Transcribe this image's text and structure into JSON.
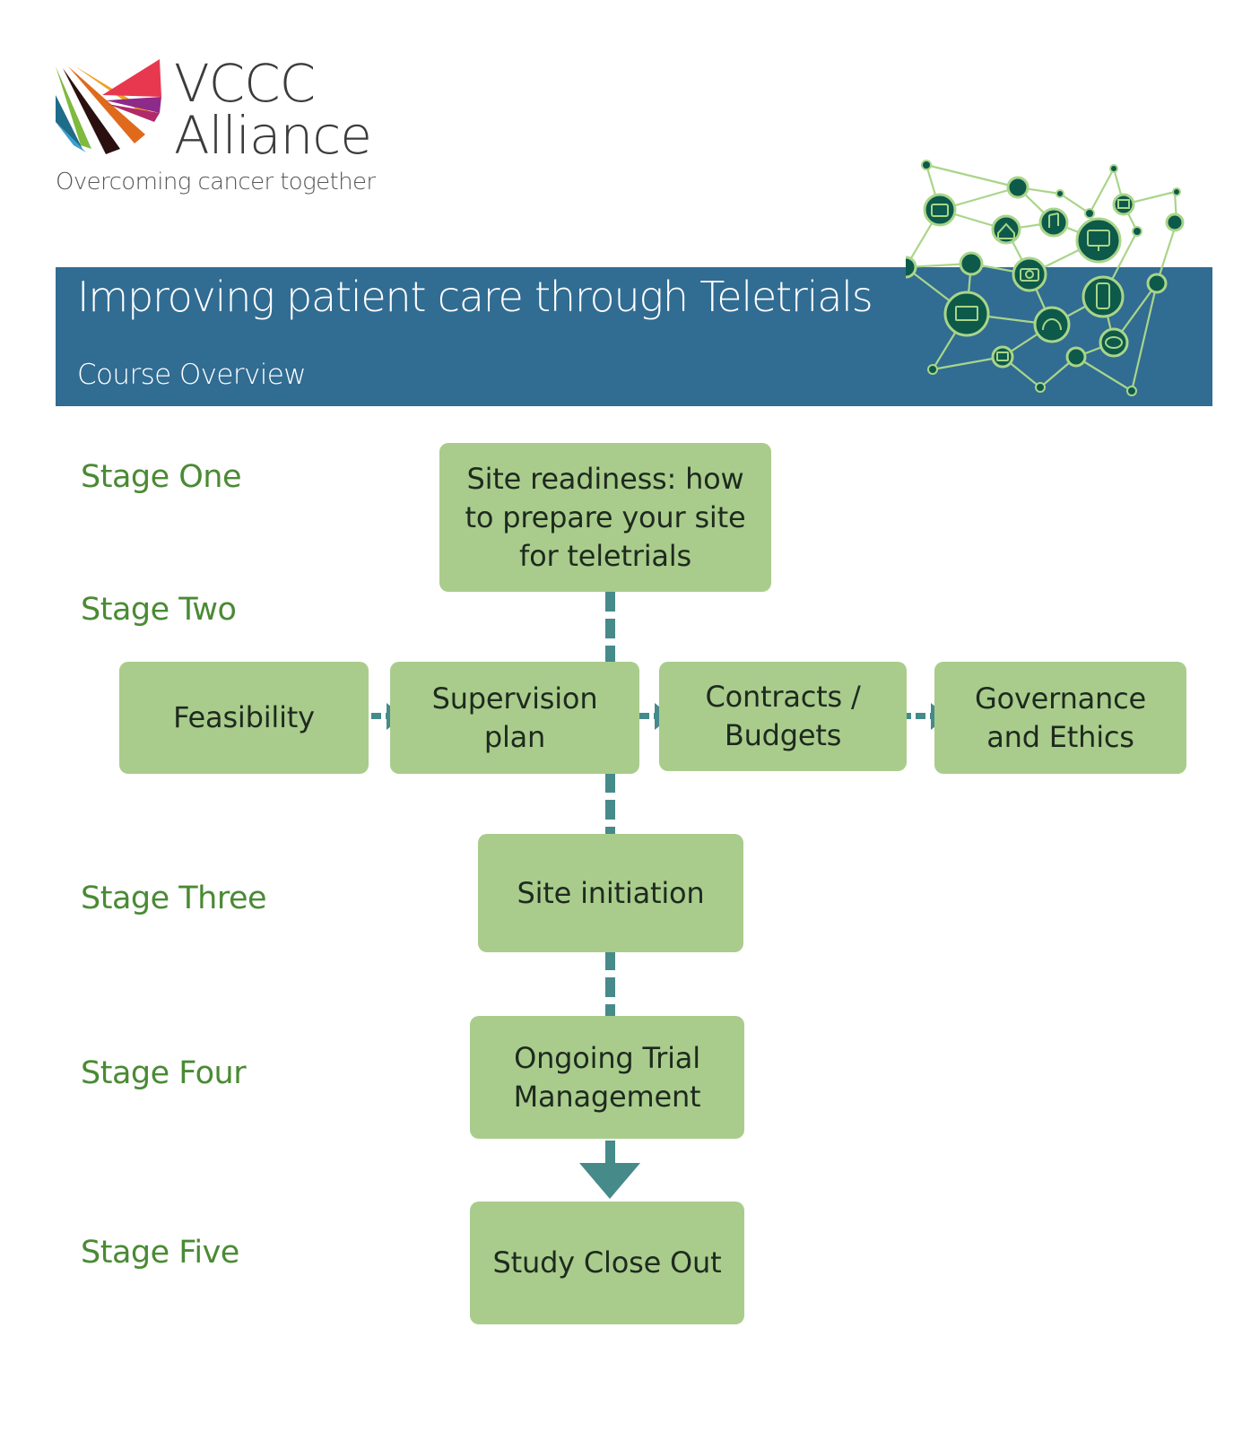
{
  "logo": {
    "line1": "VCCC",
    "line2": "Alliance",
    "tagline": "Overcoming cancer together",
    "colors": [
      "#7dba3e",
      "#f0a020",
      "#e06a1c",
      "#2b1010",
      "#2a7fb0",
      "#c4246b",
      "#8e2a8a",
      "#e8384f"
    ]
  },
  "banner": {
    "title": "Improving patient care through Teletrials",
    "subtitle": "Course Overview",
    "background": "#316c92",
    "network_icons": [
      "briefcase-icon",
      "thumbs-up-icon",
      "home-icon",
      "music-icon",
      "email-icon",
      "monitor-icon",
      "gear-icon",
      "star-icon",
      "download-icon",
      "camera-icon",
      "smartphone-icon",
      "photo-icon",
      "laptop-settings-icon",
      "headphones-icon",
      "chat-icon",
      "video-play-icon",
      "settings-icon"
    ]
  },
  "stages": [
    {
      "label": "Stage One"
    },
    {
      "label": "Stage Two"
    },
    {
      "label": "Stage Three"
    },
    {
      "label": "Stage Four"
    },
    {
      "label": "Stage Five"
    }
  ],
  "nodes": {
    "site_readiness": {
      "lines": [
        "Site readiness:  how",
        "to prepare your site",
        "for teletrials"
      ]
    },
    "feasibility": {
      "lines": [
        "Feasibility"
      ]
    },
    "supervision": {
      "lines": [
        "Supervision",
        "plan"
      ]
    },
    "contracts": {
      "lines": [
        "Contracts /",
        "Budgets"
      ]
    },
    "governance": {
      "lines": [
        "Governance",
        "and Ethics"
      ]
    },
    "site_initiation": {
      "lines": [
        "Site initiation"
      ]
    },
    "ongoing": {
      "lines": [
        "Ongoing Trial",
        "Management"
      ]
    },
    "close_out": {
      "lines": [
        "Study Close Out"
      ]
    }
  },
  "edges": [
    {
      "from": "Site readiness",
      "to": "Supervision plan",
      "style": "dashed"
    },
    {
      "from": "Feasibility",
      "to": "Supervision plan",
      "style": "dashed-arrow"
    },
    {
      "from": "Supervision plan",
      "to": "Contracts / Budgets",
      "style": "dashed-arrow"
    },
    {
      "from": "Contracts / Budgets",
      "to": "Governance and Ethics",
      "style": "dashed-arrow"
    },
    {
      "from": "Supervision plan",
      "to": "Site initiation",
      "style": "dashed"
    },
    {
      "from": "Site initiation",
      "to": "Ongoing Trial Management",
      "style": "dashed"
    },
    {
      "from": "Ongoing Trial Management",
      "to": "Study Close Out",
      "style": "solid-arrow"
    }
  ],
  "colors": {
    "box_fill": "#a9cc8c",
    "stage_text": "#4a8a34",
    "connector": "#468a8a"
  }
}
